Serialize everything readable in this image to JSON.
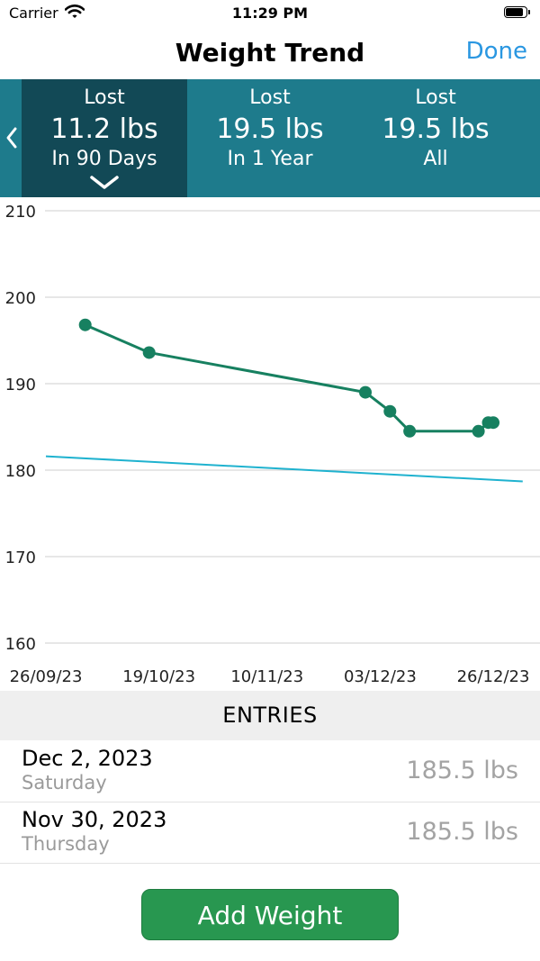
{
  "status_bar": {
    "carrier": "Carrier",
    "time": "11:29 PM"
  },
  "nav": {
    "title": "Weight Trend",
    "done_label": "Done"
  },
  "summary": {
    "periods": [
      {
        "line1": "Lost",
        "value": "11.2 lbs",
        "line3": "In 90 Days",
        "selected": true
      },
      {
        "line1": "Lost",
        "value": "19.5 lbs",
        "line3": "In 1 Year",
        "selected": false
      },
      {
        "line1": "Lost",
        "value": "19.5 lbs",
        "line3": "All",
        "selected": false
      }
    ]
  },
  "chart_data": {
    "type": "line",
    "ylim": [
      160,
      210
    ],
    "yticks": [
      "160",
      "170",
      "180",
      "190",
      "200",
      "210"
    ],
    "xticks": [
      "26/09/23",
      "19/10/23",
      "10/11/23",
      "03/12/23",
      "26/12/23"
    ],
    "grid": true,
    "series": [
      {
        "color": "#178060",
        "x": [
          "2023-10-04",
          "2023-10-17",
          "2023-11-30",
          "2023-12-05",
          "2023-12-09",
          "2023-12-23",
          "2023-12-25",
          "2023-12-26"
        ],
        "y": [
          196.8,
          193.6,
          189.0,
          186.8,
          184.5,
          184.5,
          185.5,
          185.5
        ]
      },
      {
        "color": "#1fb2cf",
        "x": [
          "2023-09-26",
          "2024-01-01"
        ],
        "y": [
          181.6,
          178.7
        ]
      }
    ]
  },
  "entries": {
    "header": "ENTRIES",
    "rows": [
      {
        "date": "Dec 2, 2023",
        "weekday": "Saturday",
        "weight": "185.5 lbs"
      },
      {
        "date": "Nov 30, 2023",
        "weekday": "Thursday",
        "weight": "185.5 lbs"
      }
    ]
  },
  "add_button": {
    "label": "Add Weight"
  },
  "colors": {
    "band": "#1e7b8c",
    "band_selected": "#124956",
    "accent_blue": "#2a97e1",
    "add_button": "#289750"
  }
}
